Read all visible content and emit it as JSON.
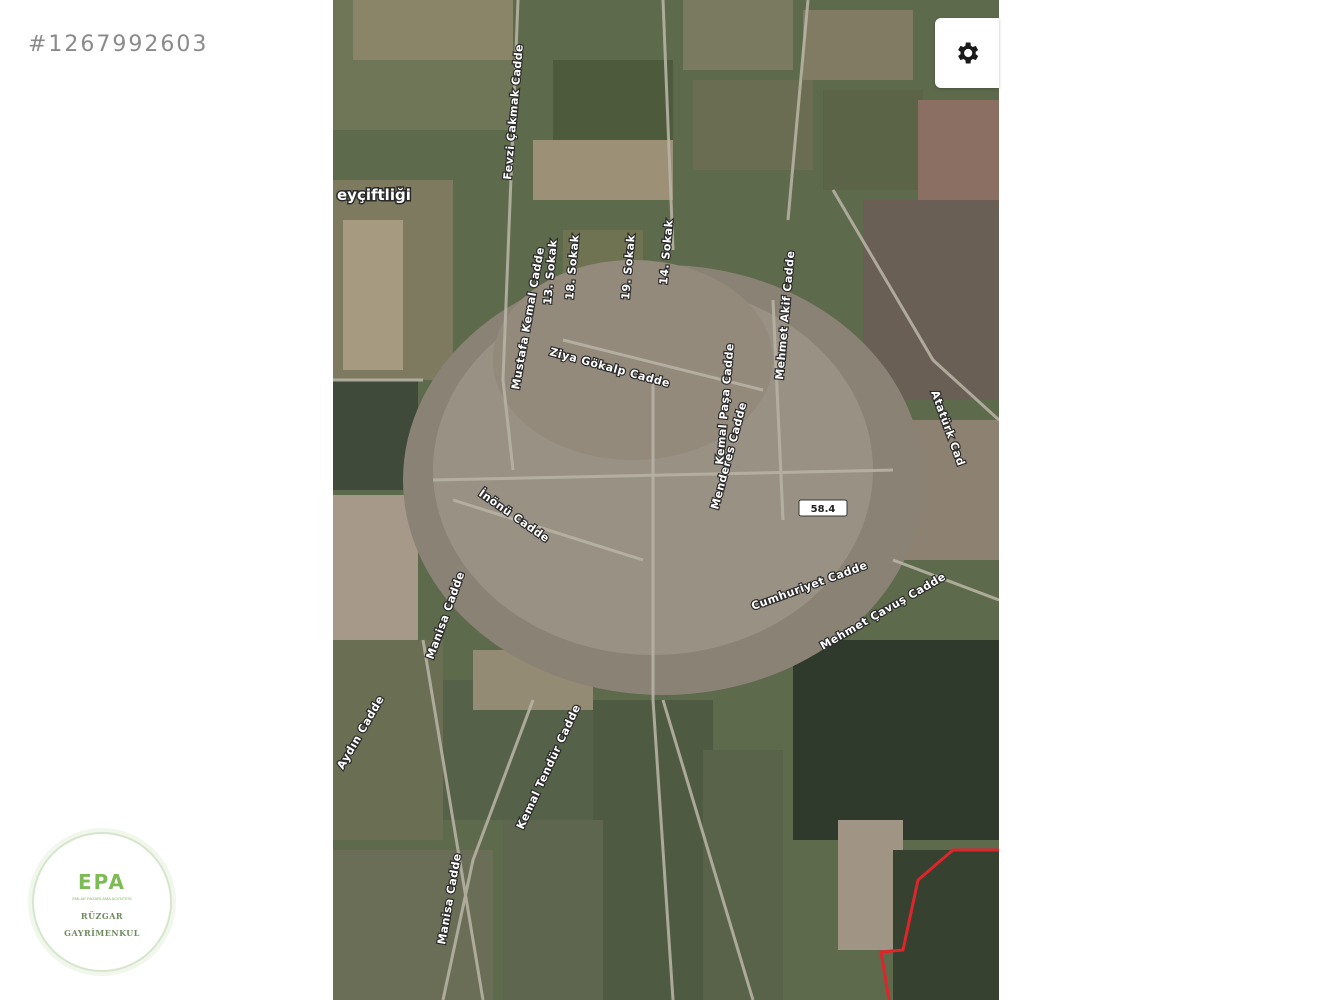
{
  "listing": {
    "id": "#1267992603"
  },
  "map": {
    "type": "satellite",
    "place_label": "eyçiftliği",
    "road_number": "58.4",
    "street_labels": [
      "Fevzi Çakmak Cadde",
      "13. Sokak",
      "18. Sokak",
      "19. Sokak",
      "14. Sokak",
      "Mustafa Kemal Cadde",
      "Ziya Gökalp Cadde",
      "Mehmet Akif Cadde",
      "Atatürk Cad",
      "İnönü Cadde",
      "Menderes Cadde",
      "Cumhuriyet Cadde",
      "Kemal Paşa Cadde",
      "Mehmet Çavuş Cadde",
      "Manisa Cadde",
      "Aydın Cadde",
      "Kemal Tendür Cadde",
      "Manisa Cadde"
    ],
    "boundary_color": "#e0242b"
  },
  "controls": {
    "settings_icon": "gear-icon"
  },
  "logo": {
    "mark": "EPA",
    "tagline": "EMLAK PAZARLAMA ACENTESİ",
    "line1": "RÜZGAR",
    "line2": "GAYRİMENKUL",
    "color": "#7dbb55"
  }
}
